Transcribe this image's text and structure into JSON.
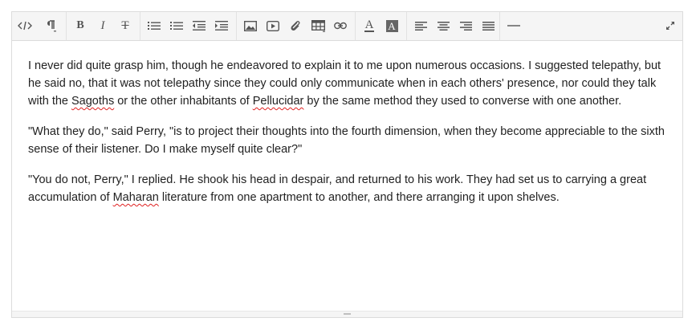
{
  "toolbar": {
    "buttons": [
      {
        "name": "code-view-button",
        "icon": "code-icon"
      },
      {
        "name": "paragraph-format-button",
        "icon": "paragraph-icon"
      },
      {
        "name": "bold-button",
        "icon": "bold-icon"
      },
      {
        "name": "italic-button",
        "icon": "italic-icon"
      },
      {
        "name": "strikethrough-button",
        "icon": "strikethrough-icon"
      },
      {
        "name": "unordered-list-button",
        "icon": "bullet-list-icon"
      },
      {
        "name": "ordered-list-button",
        "icon": "numbered-list-icon"
      },
      {
        "name": "outdent-button",
        "icon": "outdent-icon"
      },
      {
        "name": "indent-button",
        "icon": "indent-icon"
      },
      {
        "name": "insert-image-button",
        "icon": "image-icon"
      },
      {
        "name": "insert-video-button",
        "icon": "video-icon"
      },
      {
        "name": "insert-file-button",
        "icon": "paperclip-icon"
      },
      {
        "name": "insert-table-button",
        "icon": "table-icon"
      },
      {
        "name": "insert-link-button",
        "icon": "link-icon"
      },
      {
        "name": "text-color-button",
        "icon": "text-color-icon"
      },
      {
        "name": "background-color-button",
        "icon": "background-color-icon"
      },
      {
        "name": "align-left-button",
        "icon": "align-left-icon"
      },
      {
        "name": "align-center-button",
        "icon": "align-center-icon"
      },
      {
        "name": "align-right-button",
        "icon": "align-right-icon"
      },
      {
        "name": "align-justify-button",
        "icon": "align-justify-icon"
      },
      {
        "name": "horizontal-rule-button",
        "icon": "horizontal-rule-icon"
      },
      {
        "name": "fullscreen-button",
        "icon": "expand-icon"
      }
    ],
    "bold_glyph": "B",
    "italic_glyph": "I",
    "strike_glyph": "T",
    "text_color_glyph": "A",
    "bg_color_glyph": "A"
  },
  "content": {
    "p1": {
      "a": "I never did quite grasp him, though he endeavored to explain it to me upon numerous occasions. I suggested telepathy, but he said no, that it was not telepathy since they could only communicate when in each others' presence, nor could they talk with the ",
      "w1": "Sagoths",
      "b": " or the other inhabitants of ",
      "w2": "Pellucidar",
      "c": " by the same method they used to converse with one another."
    },
    "p2": "\"What they do,\" said Perry, \"is to project their thoughts into the fourth dimension, when they become appreciable to the sixth sense of their listener. Do I make myself quite clear?\"",
    "p3": {
      "a": "\"You do not, Perry,\" I replied. He shook his head in despair, and returned to his work. They had set us to carrying a great accumulation of ",
      "w1": "Maharan",
      "b": " literature from one apartment to another, and there arranging it upon shelves."
    }
  },
  "colors": {
    "toolbar_bg": "#f5f5f5",
    "border": "#dcdcdc",
    "icon": "#555555",
    "spellcheck": "#e02020",
    "text": "#222222"
  }
}
